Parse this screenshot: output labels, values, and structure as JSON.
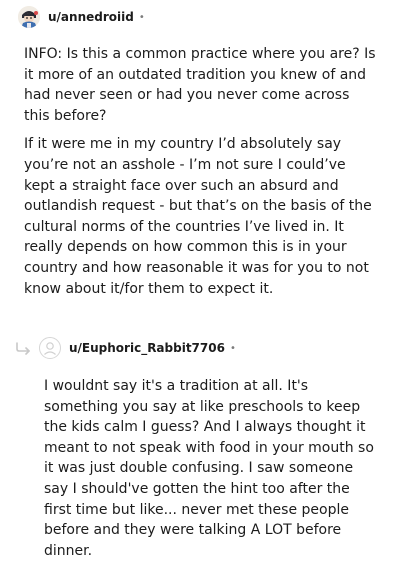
{
  "comments": [
    {
      "username": "u/annedroiid",
      "separator": "•",
      "avatar_icon": "avatar-icon",
      "paragraphs": [
        "INFO: Is this a common practice where you are? Is it more of an outdated tradition you knew of and had never seen or had you never come across this before?",
        "If it were me in my country I’d absolutely say you’re not an asshole - I’m not sure I could’ve kept a straight face over such an absurd and outlandish request - but that’s on the basis of the cultural norms of the countries I’ve lived in. It really depends on how common this is in your country and how reasonable it was for you to not know about it/for them to expect it."
      ]
    },
    {
      "username": "u/Euphoric_Rabbit7706",
      "separator": "•",
      "avatar_icon": "default-avatar-icon",
      "reply_icon": "reply-arrow-icon",
      "paragraphs": [
        "I wouldnt say it's a tradition at all. It's something you say at like preschools to keep the kids calm I guess? And I always thought it meant to not speak with food in your mouth so it was just double confusing. I saw someone say I should've gotten the hint too after the first time but like... never met these people before and they were talking A LOT before dinner."
      ]
    }
  ]
}
